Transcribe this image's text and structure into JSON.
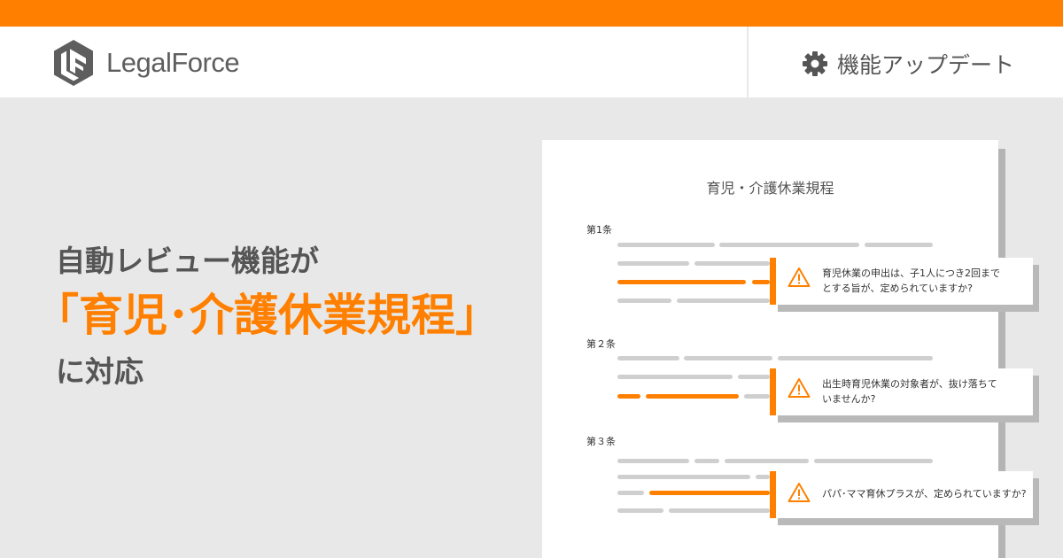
{
  "brand": {
    "name": "LegalForce",
    "accent": "#ff8000"
  },
  "header": {
    "update_label": "機能アップデート",
    "update_icon": "gear-icon"
  },
  "headline": {
    "line1": "自動レビュー機能が",
    "line2": "「育児･介護休業規程」",
    "line3": "に対応"
  },
  "document": {
    "title": "育児・介護休業規程",
    "articles": [
      {
        "label": "第1条",
        "alert_lines": [
          "育児休業の申出は、子1人につき2回まで",
          "とする旨が、定められていますか?"
        ]
      },
      {
        "label": "第２条",
        "alert_lines": [
          "出生時育児休業の対象者が、抜け落ちて",
          "いませんか?"
        ]
      },
      {
        "label": "第３条",
        "alert_lines": [
          "パパ･ママ育休プラスが、定められていますか?"
        ]
      }
    ],
    "alert_icon": "warning-icon"
  }
}
